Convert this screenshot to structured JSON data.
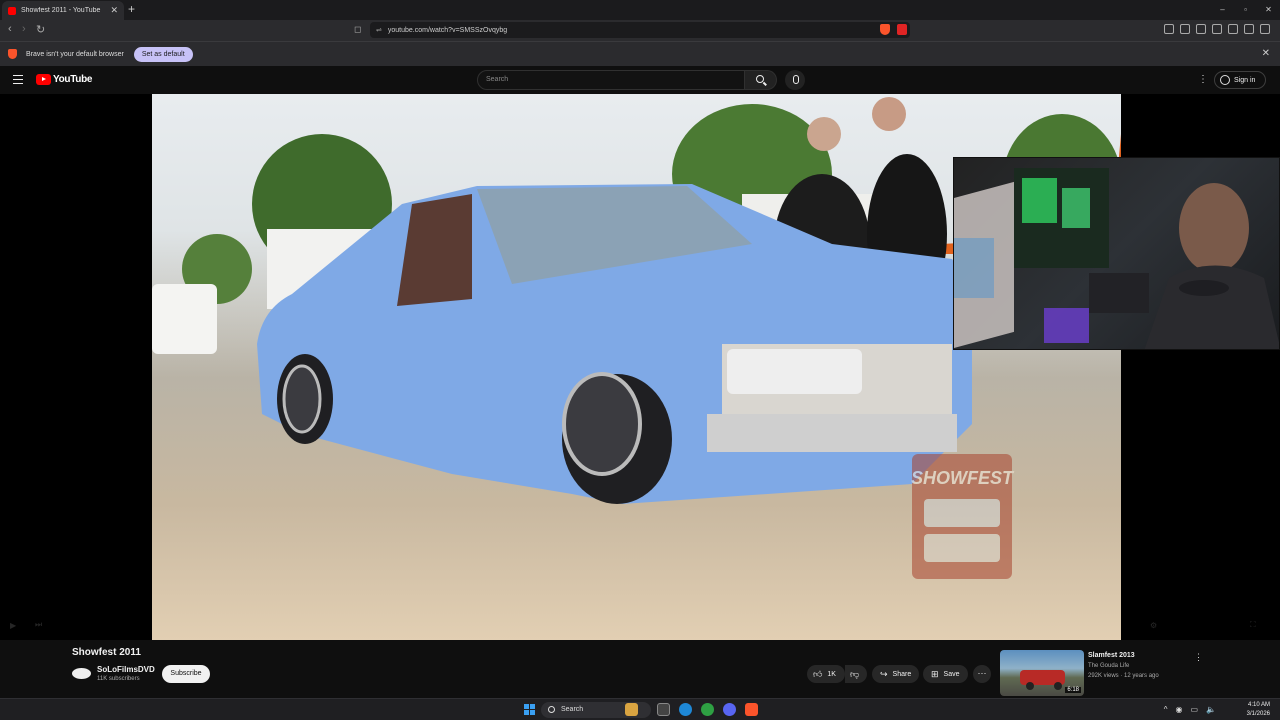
{
  "browser": {
    "tab_title": "Showfest 2011 - YouTube",
    "tab_close": "✕",
    "new_tab": "+",
    "url": "youtube.com/watch?v=SMSSzOvqybg",
    "window_controls": [
      "–",
      "▫",
      "✕"
    ]
  },
  "infobar": {
    "message": "Brave isn't your default browser",
    "set_default_label": "Set as default",
    "close": "✕"
  },
  "youtube": {
    "logo_text": "YouTube",
    "search_placeholder": "Search",
    "sign_in_label": "Sign in",
    "more_icon": "⋮"
  },
  "video": {
    "title": "Showfest 2011",
    "overlay_logo_text": "SHOWFEST",
    "channel_name": "SoLoFilmsDVD",
    "subscribers": "11K subscribers",
    "subscribe_label": "Subscribe",
    "like_count": "1K",
    "share_label": "Share",
    "save_label": "Save",
    "more_label": "···"
  },
  "recommended": {
    "title": "Slamfest 2013",
    "channel": "The Gouda Life",
    "meta": "292K views · 12 years ago",
    "duration": "6:18",
    "more_icon": "⋮"
  },
  "taskbar": {
    "search_label": "Search",
    "time": "4:10 AM",
    "date": "3/1/2026",
    "tray_icons": [
      "^",
      "◉",
      "▭",
      "🔈"
    ]
  },
  "colors": {
    "youtube_red": "#ff0000",
    "brave_orange": "#fb542b",
    "set_default_bg": "#c7c2f7",
    "truck_blue": "#7fa9e6"
  }
}
